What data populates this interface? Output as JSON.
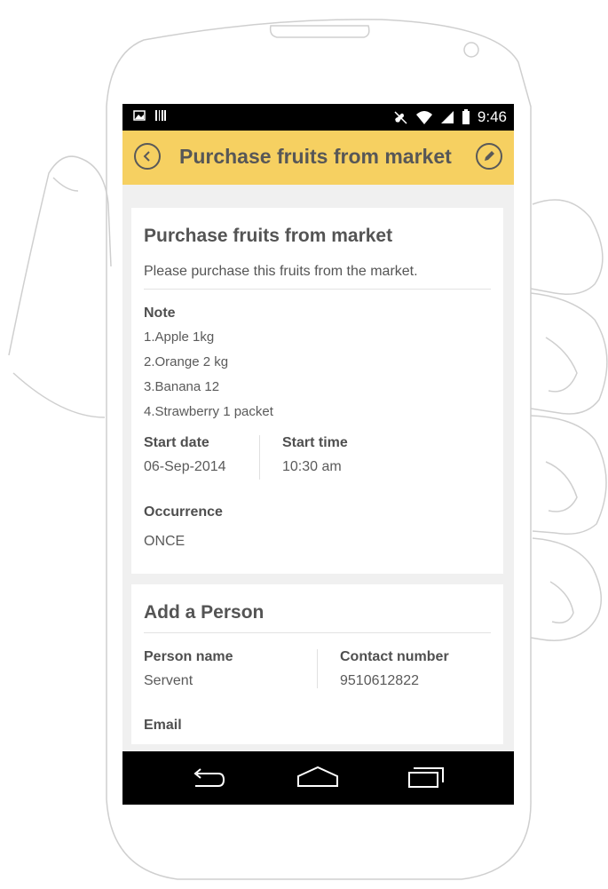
{
  "status_bar": {
    "time": "9:46"
  },
  "app_bar": {
    "title": "Purchase fruits from market"
  },
  "task": {
    "title": "Purchase fruits from market",
    "description": "Please purchase this fruits from the market.",
    "note_label": "Note",
    "note_items": [
      "1.Apple 1kg",
      "2.Orange 2 kg",
      "3.Banana 12",
      "4.Strawberry 1 packet"
    ],
    "start_date_label": "Start date",
    "start_date": "06-Sep-2014",
    "start_time_label": "Start time",
    "start_time": "10:30 am",
    "occurrence_label": "Occurrence",
    "occurrence": "ONCE"
  },
  "person": {
    "heading": "Add a Person",
    "name_label": "Person name",
    "name": "Servent",
    "contact_label": "Contact number",
    "contact": "9510612822",
    "email_label": "Email"
  },
  "nav_icons": [
    "back-icon",
    "home-icon",
    "recent-apps-icon"
  ],
  "colors": {
    "app_bar": "#f6d061",
    "background": "#f0f0f0",
    "text": "#555555"
  }
}
